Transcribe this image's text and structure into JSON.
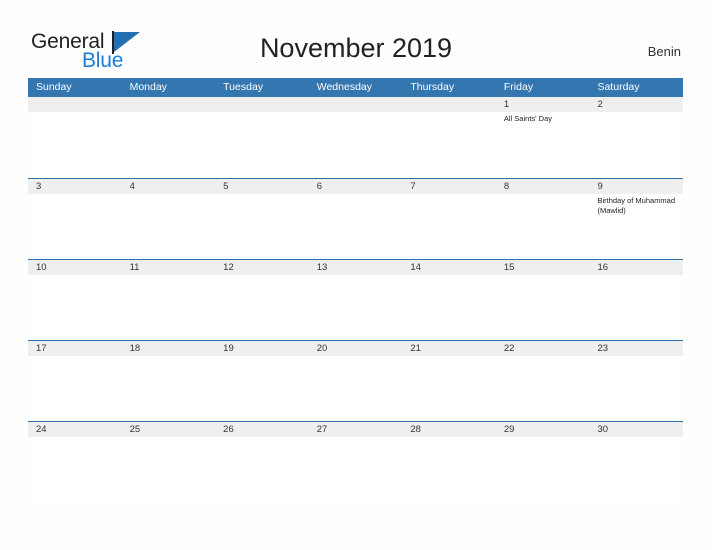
{
  "brand": {
    "name_part1": "General",
    "name_part2": "Blue",
    "flag_icon": "triangle-flag-icon",
    "colors": {
      "general_text": "#231f20",
      "blue_text": "#1a7fd4",
      "flag_blue": "#2470b4"
    }
  },
  "header": {
    "title": "November 2019",
    "country": "Benin"
  },
  "calendar": {
    "colors": {
      "header_blue": "#3476b0",
      "row_separator_blue": "#2f6fa8",
      "date_band_gray": "#efefef",
      "cell_white": "#ffffff"
    },
    "weekdays": [
      "Sunday",
      "Monday",
      "Tuesday",
      "Wednesday",
      "Thursday",
      "Friday",
      "Saturday"
    ],
    "weeks": [
      [
        {
          "day": "",
          "events": []
        },
        {
          "day": "",
          "events": []
        },
        {
          "day": "",
          "events": []
        },
        {
          "day": "",
          "events": []
        },
        {
          "day": "",
          "events": []
        },
        {
          "day": "1",
          "events": [
            "All Saints' Day"
          ]
        },
        {
          "day": "2",
          "events": []
        }
      ],
      [
        {
          "day": "3",
          "events": []
        },
        {
          "day": "4",
          "events": []
        },
        {
          "day": "5",
          "events": []
        },
        {
          "day": "6",
          "events": []
        },
        {
          "day": "7",
          "events": []
        },
        {
          "day": "8",
          "events": []
        },
        {
          "day": "9",
          "events": [
            "Birthday of Muhammad (Mawlid)"
          ]
        }
      ],
      [
        {
          "day": "10",
          "events": []
        },
        {
          "day": "11",
          "events": []
        },
        {
          "day": "12",
          "events": []
        },
        {
          "day": "13",
          "events": []
        },
        {
          "day": "14",
          "events": []
        },
        {
          "day": "15",
          "events": []
        },
        {
          "day": "16",
          "events": []
        }
      ],
      [
        {
          "day": "17",
          "events": []
        },
        {
          "day": "18",
          "events": []
        },
        {
          "day": "19",
          "events": []
        },
        {
          "day": "20",
          "events": []
        },
        {
          "day": "21",
          "events": []
        },
        {
          "day": "22",
          "events": []
        },
        {
          "day": "23",
          "events": []
        }
      ],
      [
        {
          "day": "24",
          "events": []
        },
        {
          "day": "25",
          "events": []
        },
        {
          "day": "26",
          "events": []
        },
        {
          "day": "27",
          "events": []
        },
        {
          "day": "28",
          "events": []
        },
        {
          "day": "29",
          "events": []
        },
        {
          "day": "30",
          "events": []
        }
      ]
    ]
  }
}
